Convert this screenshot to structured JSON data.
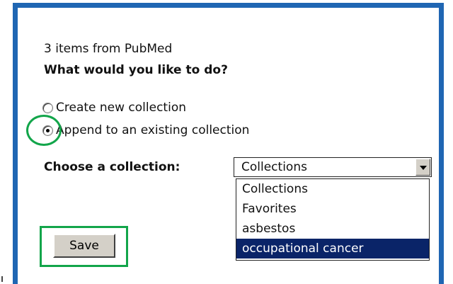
{
  "dialog": {
    "items_text": "3 items from PubMed",
    "question": "What would you like to do?",
    "options": [
      {
        "label": "Create new collection",
        "checked": false
      },
      {
        "label": "Append to an existing collection",
        "checked": true
      }
    ],
    "choose_label": "Choose a collection:",
    "select": {
      "value": "Collections",
      "options": [
        "Collections",
        "Favorites",
        "asbestos",
        "occupational cancer"
      ],
      "highlighted": "occupational cancer"
    },
    "save_label": "Save"
  },
  "colors": {
    "frame_border": "#1f66b3",
    "annotation": "#12a54a",
    "selected_option_bg": "#0a2468"
  }
}
